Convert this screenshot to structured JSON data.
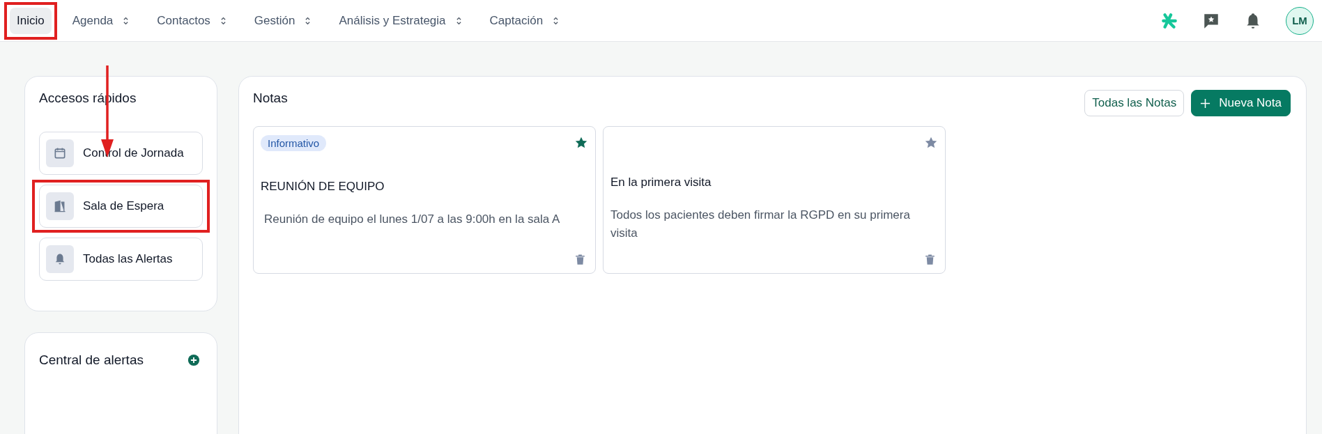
{
  "nav": {
    "items": [
      {
        "label": "Inicio",
        "selected": true,
        "dropdown": false,
        "annotated": true
      },
      {
        "label": "Agenda",
        "selected": false,
        "dropdown": true,
        "annotated": false
      },
      {
        "label": "Contactos",
        "selected": false,
        "dropdown": true,
        "annotated": false
      },
      {
        "label": "Gestión",
        "selected": false,
        "dropdown": true,
        "annotated": false
      },
      {
        "label": "Análisis y Estrategia",
        "selected": false,
        "dropdown": true,
        "annotated": false
      },
      {
        "label": "Captación",
        "selected": false,
        "dropdown": true,
        "annotated": false
      }
    ],
    "avatar": "LM"
  },
  "quick_access": {
    "title": "Accesos rápidos",
    "items": [
      {
        "label": "Control de Jornada",
        "kind": "calendar",
        "annotated": false
      },
      {
        "label": "Sala de Espera",
        "kind": "door",
        "annotated": true
      },
      {
        "label": "Todas las Alertas",
        "kind": "bell",
        "annotated": false
      }
    ]
  },
  "alerts": {
    "title": "Central de alertas"
  },
  "notes": {
    "title": "Notas",
    "buttons": [
      "Todas las Notas",
      "Nueva Nota"
    ],
    "items": [
      {
        "tag": "Informativo",
        "favorite": true,
        "title": "REUNIÓN DE EQUIPO",
        "text": "Reunión de equipo el lunes 1/07 a las 9:00h en la sala A"
      },
      {
        "favorite": false,
        "title": "En la primera visita",
        "text": "Todos los pacientes deben firmar la RGPD en su primera visita"
      }
    ]
  }
}
